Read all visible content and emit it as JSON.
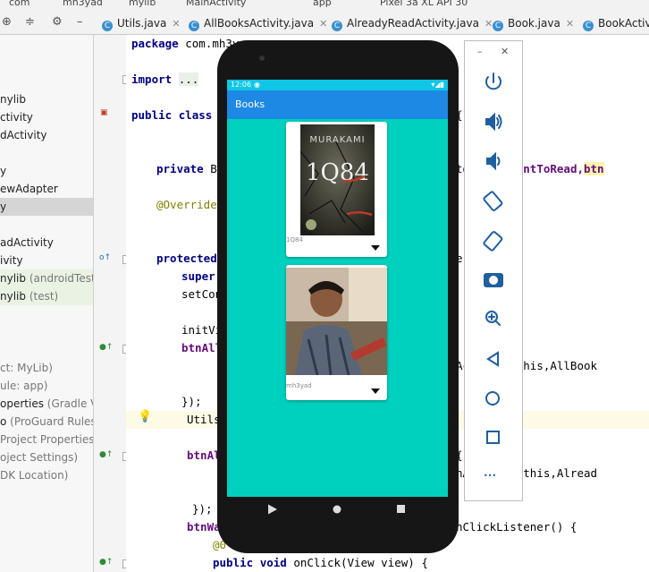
{
  "breadcrumb": [
    "com",
    "mh3yad",
    "mylib",
    "MainActivity",
    "app",
    "Pixel 3a XL API 30"
  ],
  "tabs": [
    {
      "label": "Utils.java"
    },
    {
      "label": "AllBooksActivity.java"
    },
    {
      "label": "AlreadyReadActivity.java"
    },
    {
      "label": "Book.java"
    },
    {
      "label": "BookActiv"
    }
  ],
  "project_tree": [
    {
      "text": "nylib",
      "suffix": ""
    },
    {
      "text": "ctivity",
      "suffix": ""
    },
    {
      "text": "dActivity",
      "suffix": ""
    },
    {
      "text": "",
      "suffix": ""
    },
    {
      "text": "y",
      "suffix": ""
    },
    {
      "text": "ewAdapter",
      "suffix": ""
    },
    {
      "text": "y",
      "suffix": ""
    },
    {
      "text": "",
      "suffix": ""
    },
    {
      "text": "adActivity",
      "suffix": ""
    },
    {
      "text": "ivity",
      "suffix": ""
    },
    {
      "text": "nylib",
      "suffix": " (androidTest)"
    },
    {
      "text": "nylib",
      "suffix": " (test)"
    },
    {
      "text": "",
      "suffix": ""
    },
    {
      "text": "",
      "suffix": ""
    },
    {
      "text": "ct: MyLib)",
      "suffix": ""
    },
    {
      "text": "ule: app)",
      "suffix": ""
    },
    {
      "text": "operties",
      "suffix": " (Gradle Vers"
    },
    {
      "text": "o",
      "suffix": " (ProGuard Rules fo"
    },
    {
      "text": "",
      "suffix": "Project Properties)"
    },
    {
      "text": "",
      "suffix": "oject Settings)"
    },
    {
      "text": "",
      "suffix": "DK Location)"
    }
  ],
  "code": {
    "package_kw": "package",
    "package_name": "com.mh3ya",
    "import_kw": "import",
    "import_dots": "...",
    "class_public": "public",
    "class_kw": "class",
    "class_name": "M",
    "class_brace": "{",
    "private_kw": "private",
    "private_type": "Bu",
    "private_tail_fields1": "ead,btnWantToRead,",
    "private_tail_field2": "btn",
    "override": "@Override",
    "protected_kw": "protected",
    "protected_tail": "e",
    "super_kw": "super",
    "set_content": "setCon",
    "init_views": "initVi",
    "btn_all": "btnAll",
    "activity_this_all": "Activity.this,AllBook",
    "close1": "});",
    "utils": "Utils",
    "btn_al2": "btnAl",
    "brace2": "{",
    "activity_this_already": "nActivity.this,Alread",
    "close2": "});",
    "btn_want": "btnWa",
    "on_click_listener": "nClickListener() {",
    "override2": "@0",
    "public_kw": "public",
    "void_kw": "void",
    "on_click": "onClick(View view) {"
  },
  "emulator": {
    "status_time": "12:06",
    "app_title": "Books",
    "books": [
      {
        "name": "1Q84",
        "cover_author": "MURAKAMI",
        "cover_title": "1Q84"
      },
      {
        "name": "mh3yad"
      }
    ],
    "nav_icons": [
      "back-icon",
      "home-icon",
      "recents-icon"
    ]
  },
  "emu_panel": {
    "window_buttons": [
      "minimize-icon",
      "close-icon"
    ],
    "minimize": "–",
    "close": "✕",
    "more": "•••",
    "icons": [
      "power-icon",
      "volume-up-icon",
      "volume-down-icon",
      "rotate-left-icon",
      "rotate-right-icon",
      "camera-icon",
      "zoom-icon",
      "back-icon",
      "home-icon",
      "overview-icon",
      "more-icon"
    ]
  },
  "colors": {
    "app_background": "#00d1be",
    "app_bar": "#1e88e5",
    "status_bar": "#0fc6e6",
    "emu_icon": "#1f5f9e"
  }
}
